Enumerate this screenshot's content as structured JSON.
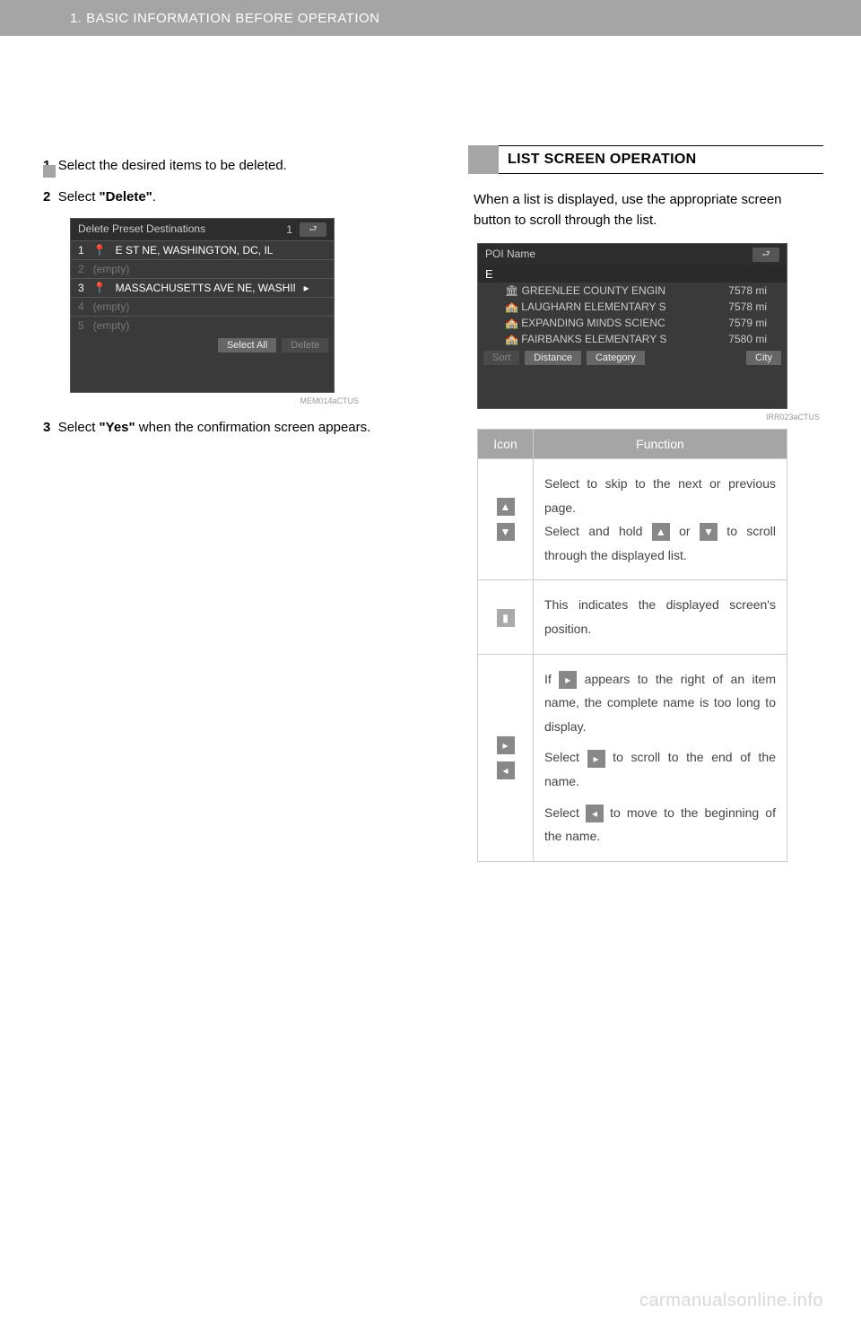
{
  "header": {
    "breadcrumb": "1. BASIC INFORMATION BEFORE OPERATION"
  },
  "left": {
    "step1": "Select the desired items to be deleted.",
    "step2_prefix": "Select ",
    "step2_bold": "\"Delete\"",
    "step2_suffix": ".",
    "step3_prefix": "Select ",
    "step3_bold": "\"Yes\"",
    "step3_suffix": " when the confirmation screen appears.",
    "screenshot": {
      "title": "Delete Preset Destinations",
      "pagebadge": "1",
      "rows": [
        {
          "num": "1",
          "text": "E ST NE, WASHINGTON, DC, IL",
          "active": true
        },
        {
          "num": "2",
          "text": "(empty)",
          "active": false
        },
        {
          "num": "3",
          "text": "MASSACHUSETTS AVE NE, WASHINGTON,",
          "active": true
        },
        {
          "num": "4",
          "text": "(empty)",
          "active": false
        },
        {
          "num": "5",
          "text": "(empty)",
          "active": false
        }
      ],
      "select_all": "Select All",
      "delete": "Delete",
      "credit": "MEM014aCTUS"
    }
  },
  "right": {
    "section_title": "LIST SCREEN OPERATION",
    "intro": "When a list is displayed, use the appropriate screen button to scroll through the list.",
    "screenshot": {
      "title": "POI Name",
      "input": "E",
      "rows": [
        {
          "name": "GREENLEE COUNTY ENGIN",
          "dist": "7578 mi"
        },
        {
          "name": "LAUGHARN ELEMENTARY S",
          "dist": "7578 mi"
        },
        {
          "name": "EXPANDING MINDS SCIENC",
          "dist": "7579 mi"
        },
        {
          "name": "FAIRBANKS ELEMENTARY S",
          "dist": "7580 mi"
        }
      ],
      "sort": "Sort",
      "distance": "Distance",
      "category": "Category",
      "city": "City",
      "credit": "IRR023aCTUS"
    },
    "table": {
      "head_icon": "Icon",
      "head_func": "Function",
      "row1_a": "Select to skip to the next or previous page.",
      "row1_b_pre": "Select and hold ",
      "row1_b_mid": " or ",
      "row1_b_post": " to scroll through the displayed list.",
      "row2": "This indicates the displayed screen's position.",
      "row3_a_pre": "If ",
      "row3_a_post": " appears to the right of an item name, the complete name is too long to display.",
      "row3_b_pre": "Select ",
      "row3_b_post": " to scroll to the end of the name.",
      "row3_c_pre": "Select ",
      "row3_c_post": " to move to the beginning of the name."
    }
  },
  "watermark": "carmanualsonline.info"
}
